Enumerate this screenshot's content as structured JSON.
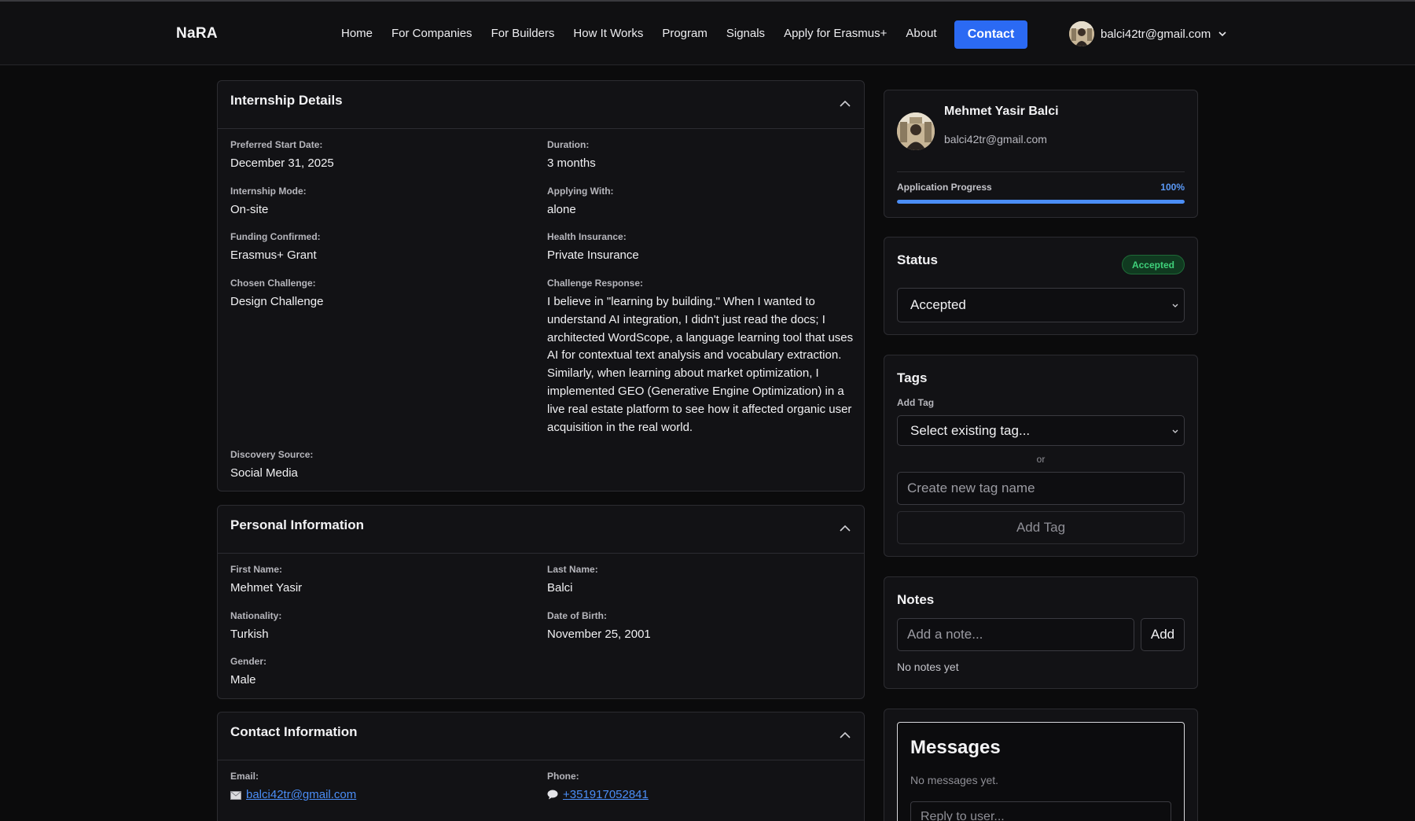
{
  "header": {
    "brand": "NaRA",
    "nav": [
      "Home",
      "For Companies",
      "For Builders",
      "How It Works",
      "Program",
      "Signals",
      "Apply for Erasmus+",
      "About"
    ],
    "contact_label": "Contact",
    "user_email": "balci42tr@gmail.com",
    "accent": "#2b6af3"
  },
  "internship": {
    "title": "Internship Details",
    "start_label": "Preferred Start Date:",
    "start_value": "December 31, 2025",
    "duration_label": "Duration:",
    "duration_value": "3 months",
    "mode_label": "Internship Mode:",
    "mode_value": "On-site",
    "applying_label": "Applying With:",
    "applying_value": "alone",
    "funding_label": "Funding Confirmed:",
    "funding_value": "Erasmus+ Grant",
    "insurance_label": "Health Insurance:",
    "insurance_value": "Private Insurance",
    "challenge_label": "Chosen Challenge:",
    "challenge_value": "Design Challenge",
    "response_label": "Challenge Response:",
    "response_value": "I believe in \"learning by building.\" When I wanted to understand AI integration, I didn't just read the docs; I architected WordScope, a language learning tool that uses AI for contextual text analysis and vocabulary extraction. Similarly, when learning about market optimization, I implemented GEO (Generative Engine Optimization) in a live real estate platform to see how it affected organic user acquisition in the real world.",
    "discovery_label": "Discovery Source:",
    "discovery_value": "Social Media"
  },
  "personal": {
    "title": "Personal Information",
    "first_label": "First Name:",
    "first_value": "Mehmet Yasir",
    "last_label": "Last Name:",
    "last_value": "Balci",
    "nationality_label": "Nationality:",
    "nationality_value": "Turkish",
    "dob_label": "Date of Birth:",
    "dob_value": "November 25, 2001",
    "gender_label": "Gender:",
    "gender_value": "Male"
  },
  "contact": {
    "title": "Contact Information",
    "email_label": "Email:",
    "email_value": "balci42tr@gmail.com",
    "phone_label": "Phone:",
    "phone_value": "+351917052841"
  },
  "profile": {
    "name": "Mehmet Yasir Balci",
    "email": "balci42tr@gmail.com",
    "progress_label": "Application Progress",
    "progress_text": "100%",
    "progress_value": 1.0
  },
  "status": {
    "title": "Status",
    "badge": "Accepted",
    "selected": "Accepted",
    "badge_color": "#3fd17a"
  },
  "tags": {
    "title": "Tags",
    "add_label": "Add Tag",
    "select_placeholder": "Select existing tag...",
    "or": "or",
    "new_placeholder": "Create new tag name",
    "add_button": "Add Tag"
  },
  "notes": {
    "title": "Notes",
    "placeholder": "Add a note...",
    "add_button": "Add",
    "empty": "No notes yet"
  },
  "messages": {
    "title": "Messages",
    "empty": "No messages yet.",
    "placeholder": "Reply to user..."
  }
}
